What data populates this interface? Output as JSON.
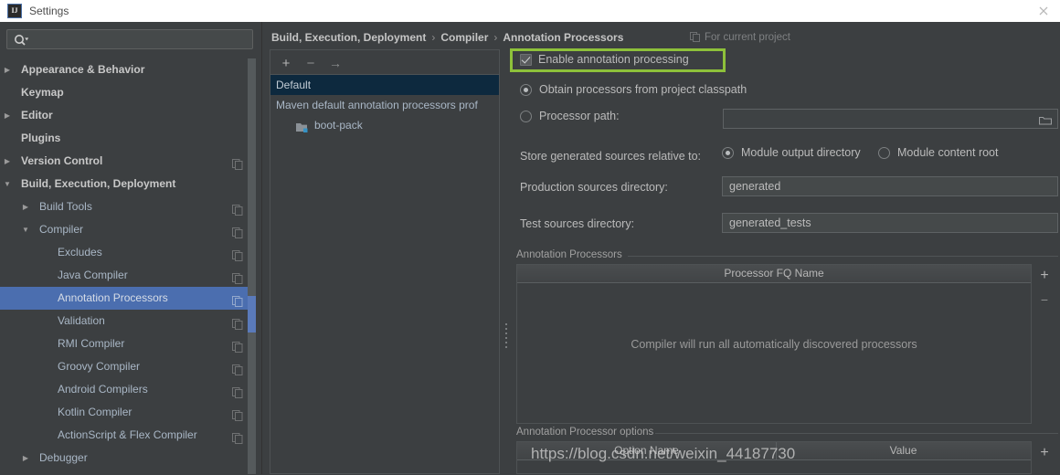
{
  "window": {
    "title": "Settings",
    "app_icon": "IJ",
    "close_icon": "close-icon"
  },
  "sidebar": {
    "search_placeholder": "",
    "search_value": "",
    "items": [
      {
        "label": "Appearance & Behavior",
        "level": 0,
        "arrow": "▶",
        "bold": true,
        "copy": false,
        "selected": false
      },
      {
        "label": "Keymap",
        "level": 0,
        "arrow": "",
        "bold": true,
        "copy": false,
        "selected": false
      },
      {
        "label": "Editor",
        "level": 0,
        "arrow": "▶",
        "bold": true,
        "copy": false,
        "selected": false
      },
      {
        "label": "Plugins",
        "level": 0,
        "arrow": "",
        "bold": true,
        "copy": false,
        "selected": false
      },
      {
        "label": "Version Control",
        "level": 0,
        "arrow": "▶",
        "bold": true,
        "copy": true,
        "selected": false
      },
      {
        "label": "Build, Execution, Deployment",
        "level": 0,
        "arrow": "▼",
        "bold": true,
        "copy": false,
        "selected": false
      },
      {
        "label": "Build Tools",
        "level": 1,
        "arrow": "▶",
        "bold": false,
        "copy": true,
        "selected": false
      },
      {
        "label": "Compiler",
        "level": 1,
        "arrow": "▼",
        "bold": false,
        "copy": true,
        "selected": false
      },
      {
        "label": "Excludes",
        "level": 2,
        "arrow": "",
        "bold": false,
        "copy": true,
        "selected": false
      },
      {
        "label": "Java Compiler",
        "level": 2,
        "arrow": "",
        "bold": false,
        "copy": true,
        "selected": false
      },
      {
        "label": "Annotation Processors",
        "level": 2,
        "arrow": "",
        "bold": false,
        "copy": true,
        "selected": true
      },
      {
        "label": "Validation",
        "level": 2,
        "arrow": "",
        "bold": false,
        "copy": true,
        "selected": false
      },
      {
        "label": "RMI Compiler",
        "level": 2,
        "arrow": "",
        "bold": false,
        "copy": true,
        "selected": false
      },
      {
        "label": "Groovy Compiler",
        "level": 2,
        "arrow": "",
        "bold": false,
        "copy": true,
        "selected": false
      },
      {
        "label": "Android Compilers",
        "level": 2,
        "arrow": "",
        "bold": false,
        "copy": true,
        "selected": false
      },
      {
        "label": "Kotlin Compiler",
        "level": 2,
        "arrow": "",
        "bold": false,
        "copy": true,
        "selected": false
      },
      {
        "label": "ActionScript & Flex Compiler",
        "level": 2,
        "arrow": "",
        "bold": false,
        "copy": true,
        "selected": false
      },
      {
        "label": "Debugger",
        "level": 1,
        "arrow": "▶",
        "bold": false,
        "copy": false,
        "selected": false
      }
    ]
  },
  "header": {
    "breadcrumb": [
      "Build, Execution, Deployment",
      "Compiler",
      "Annotation Processors"
    ],
    "separator": "›",
    "scope_label": "For current project",
    "scope_icon": "copy-icon"
  },
  "profiles": {
    "toolbar": {
      "add": "+",
      "remove": "−",
      "move": "→"
    },
    "items": [
      {
        "label": "Default",
        "selected": true,
        "child": false
      },
      {
        "label": "Maven default annotation processors prof",
        "selected": false,
        "child": false
      },
      {
        "label": "boot-pack",
        "selected": false,
        "child": true,
        "icon": "folder-module-icon"
      }
    ]
  },
  "settings": {
    "enable_annotation_processing": {
      "label": "Enable annotation processing",
      "checked": true,
      "highlight_color": "#8ec13a"
    },
    "processor_source": {
      "options": [
        {
          "label": "Obtain processors from project classpath",
          "selected": true
        },
        {
          "label": "Processor path:",
          "selected": false
        }
      ],
      "processor_path_value": "",
      "browse_icon": "folder-icon"
    },
    "store_sources": {
      "label": "Store generated sources relative to:",
      "options": [
        {
          "label": "Module output directory",
          "selected": true
        },
        {
          "label": "Module content root",
          "selected": false
        }
      ]
    },
    "production_sources": {
      "label": "Production sources directory:",
      "value": "generated"
    },
    "test_sources": {
      "label": "Test sources directory:",
      "value": "generated_tests"
    },
    "processors_group": {
      "title": "Annotation Processors",
      "column_header": "Processor FQ Name",
      "empty_message": "Compiler will run all automatically discovered processors",
      "add_button": "+",
      "remove_button": "−"
    },
    "options_group": {
      "title": "Annotation Processor options",
      "columns": [
        "Option Name",
        "Value"
      ],
      "add_button": "+"
    }
  },
  "watermark": {
    "text": "https://blog.csdn.net/weixin_44187730"
  }
}
